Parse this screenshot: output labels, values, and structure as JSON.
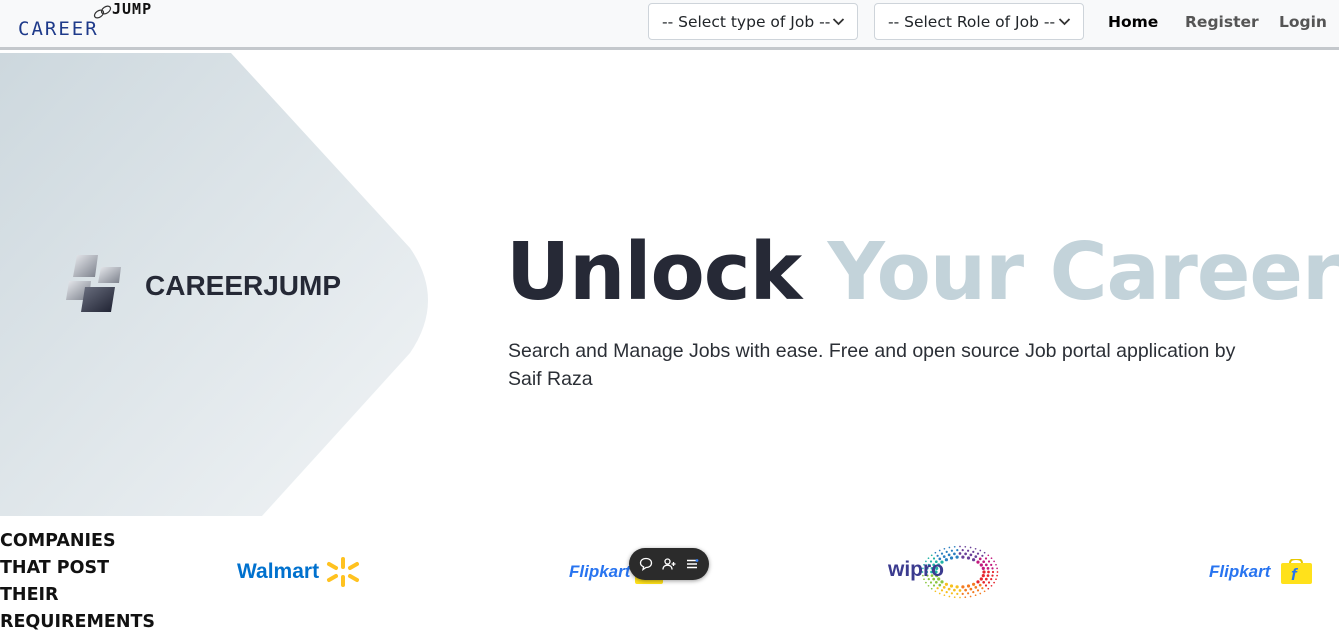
{
  "navbar": {
    "logo_left": "CAREER",
    "logo_right": "JUMP",
    "select_type": "-- Select type of Job --",
    "select_role": "-- Select Role of Job --",
    "links": [
      "Home",
      "Register",
      "Login"
    ],
    "active_link": "Home"
  },
  "hero": {
    "brand": "CAREERJUMP",
    "title_dark": "Unlock",
    "title_light": "Your Career",
    "subtitle": "Search and Manage Jobs with ease. Free and open source Job portal application by Saif Raza"
  },
  "companies": {
    "heading": "COMPANIES THAT POST THEIR REQUIREMENTS",
    "logos": [
      {
        "name": "Walmart",
        "icon": "walmart-spark-icon"
      },
      {
        "name": "Flipkart",
        "icon": "flipkart-bag-icon"
      },
      {
        "name": "wipro",
        "icon": "wipro-dots-icon"
      },
      {
        "name": "Flipkart",
        "icon": "flipkart-bag-icon"
      }
    ]
  },
  "floating_toolbar": {
    "icons": [
      "chat-icon",
      "user-add-icon",
      "menu-icon"
    ]
  },
  "colors": {
    "logo_blue": "#1e3a8a",
    "title_dark": "#262936",
    "title_light": "#c3d3da",
    "walmart_blue": "#0071ce",
    "walmart_yellow": "#ffc220",
    "flipkart_blue": "#2874f0",
    "flipkart_yellow": "#ffe11b"
  }
}
